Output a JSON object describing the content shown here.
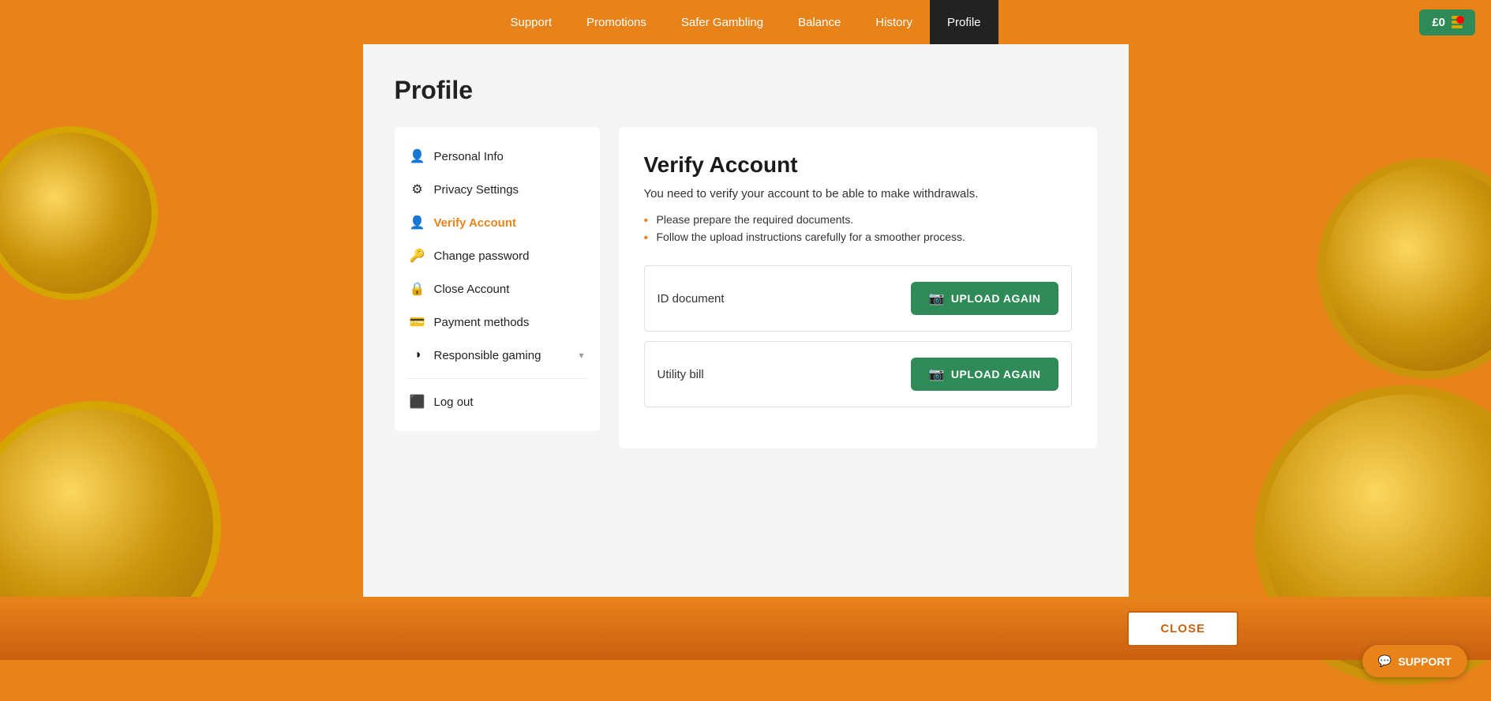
{
  "nav": {
    "links": [
      {
        "label": "Support",
        "active": false
      },
      {
        "label": "Promotions",
        "active": false
      },
      {
        "label": "Safer Gambling",
        "active": false
      },
      {
        "label": "Balance",
        "active": false
      },
      {
        "label": "History",
        "active": false
      },
      {
        "label": "Profile",
        "active": true
      }
    ],
    "balance_label": "£0",
    "balance_btn_aria": "Balance button"
  },
  "profile": {
    "title": "Profile"
  },
  "sidebar": {
    "items": [
      {
        "label": "Personal Info",
        "icon": "👤",
        "active": false,
        "name": "personal-info"
      },
      {
        "label": "Privacy Settings",
        "icon": "⚙️",
        "active": false,
        "name": "privacy-settings"
      },
      {
        "label": "Verify Account",
        "icon": "👤",
        "active": true,
        "name": "verify-account"
      },
      {
        "label": "Change password",
        "icon": "🔑",
        "active": false,
        "name": "change-password"
      },
      {
        "label": "Close Account",
        "icon": "🔒",
        "active": false,
        "name": "close-account"
      },
      {
        "label": "Payment methods",
        "icon": "💳",
        "active": false,
        "name": "payment-methods"
      },
      {
        "label": "Responsible gaming",
        "icon": "◑",
        "active": false,
        "name": "responsible-gaming",
        "has_chevron": true
      }
    ],
    "logout": {
      "label": "Log out",
      "icon": "🚪"
    }
  },
  "verify": {
    "title": "Verify Account",
    "description": "You need to verify your account to be able to make withdrawals.",
    "bullets": [
      "Please prepare the required documents.",
      "Follow the upload instructions carefully for a smoother process."
    ],
    "documents": [
      {
        "name": "ID document",
        "upload_label": "UPLOAD AGAIN"
      },
      {
        "name": "Utility bill",
        "upload_label": "UPLOAD AGAIN"
      }
    ]
  },
  "footer": {
    "close_label": "CLOSE"
  },
  "support": {
    "label": "SUPPORT"
  }
}
